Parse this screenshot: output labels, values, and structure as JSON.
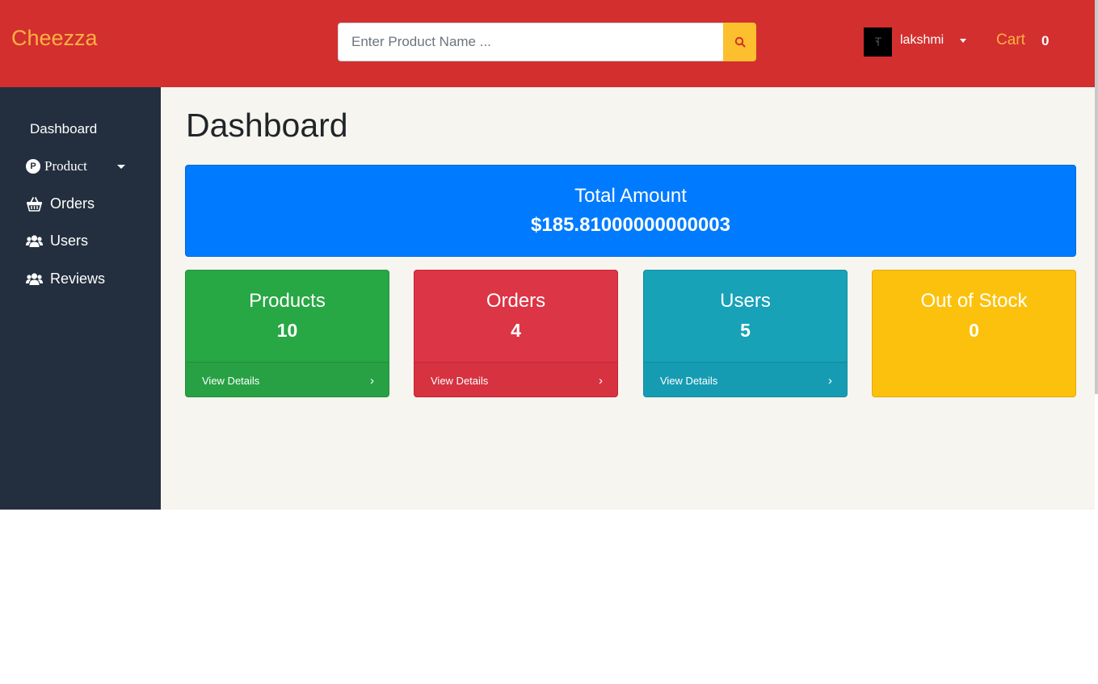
{
  "header": {
    "brand": "Cheezza",
    "search": {
      "placeholder": "Enter Product Name ..."
    },
    "user": {
      "name": "lakshmi"
    },
    "cart": {
      "label": "Cart",
      "count": "0"
    }
  },
  "sidebar": {
    "items": [
      {
        "label": "Dashboard",
        "icon": "none"
      },
      {
        "label": "Product",
        "icon": "p-circle-icon"
      },
      {
        "label": "Orders",
        "icon": "basket-icon"
      },
      {
        "label": "Users",
        "icon": "users-icon"
      },
      {
        "label": "Reviews",
        "icon": "users-icon"
      }
    ]
  },
  "main": {
    "title": "Dashboard",
    "total": {
      "label": "Total Amount",
      "value": "$185.81000000000003"
    },
    "cards": [
      {
        "title": "Products",
        "count": "10",
        "link": "View Details",
        "color": "#28a745"
      },
      {
        "title": "Orders",
        "count": "4",
        "link": "View Details",
        "color": "#dc3545"
      },
      {
        "title": "Users",
        "count": "5",
        "link": "View Details",
        "color": "#17a2b8"
      },
      {
        "title": "Out of Stock",
        "count": "0",
        "color": "#ffc107"
      }
    ]
  },
  "colors": {
    "header": "#d32f2f",
    "brand": "#fcb040",
    "sidebar": "#232f3e",
    "total_card": "#007bff",
    "search_button": "#fcc02e"
  }
}
